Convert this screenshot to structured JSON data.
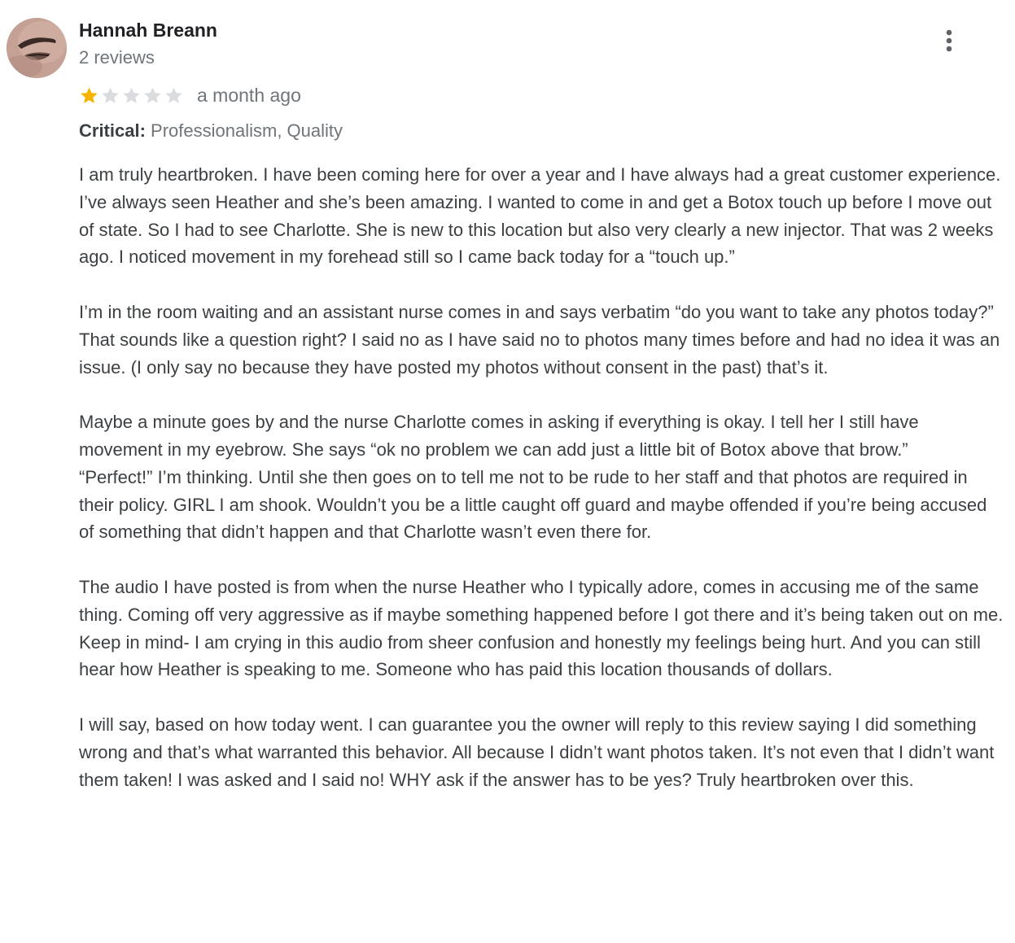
{
  "review": {
    "author_name": "Hannah Breann",
    "review_count": "2 reviews",
    "rating": {
      "value": 1,
      "max": 5,
      "filled_color": "#f4b400",
      "empty_color": "#dadce0"
    },
    "date": "a month ago",
    "critical": {
      "label": "Critical:",
      "value": "Professionalism, Quality"
    },
    "paragraphs": [
      "I am truly heartbroken. I have been coming here for over a year and I have always had a great customer experience. I’ve always seen Heather and she’s been amazing. I wanted to come in and get a Botox touch up before I move out of state. So I had to see Charlotte. She is new to this location but also very clearly a new injector. That was 2 weeks ago. I noticed movement in my forehead still so I came back today for a “touch up.”",
      "I’m in the room waiting and an assistant nurse comes in and says verbatim “do you want to take any photos today?” That sounds like a question right? I said no as I have said no to photos many times before and had no idea it was an issue. (I only say no because they have posted my photos without consent in the past) that’s it.",
      "Maybe a minute goes by and the nurse Charlotte comes in asking if everything is okay. I tell her I still have movement in my eyebrow. She says “ok no problem we can add just a little bit of Botox above that brow.”",
      "“Perfect!” I’m thinking. Until she then goes on to tell me not to be rude to her staff and that photos are required in their policy. GIRL I am shook. Wouldn’t you be a little caught off guard and maybe offended if you’re being accused of something that didn’t happen and that Charlotte wasn’t even there for.",
      "The audio I have posted is from when the nurse Heather who I typically adore, comes in accusing me of the same thing. Coming off very aggressive as if maybe something happened before I got there and it’s being taken out on me. Keep in mind- I am crying in this audio from sheer confusion and honestly my feelings being hurt. And you can still hear how Heather is speaking to me. Someone who has paid this location thousands of dollars.",
      "I will say, based on how today went. I can guarantee you the owner will reply to this review saying I did something wrong and that’s what warranted this behavior. All because I didn’t want photos taken. It’s not even that I didn’t want them taken! I was asked and I said no! WHY ask if the answer has to be yes? Truly heartbroken over this."
    ]
  },
  "icons": {
    "avatar": "profile-photo",
    "more": "more-vert-icon",
    "star": "star-icon"
  }
}
